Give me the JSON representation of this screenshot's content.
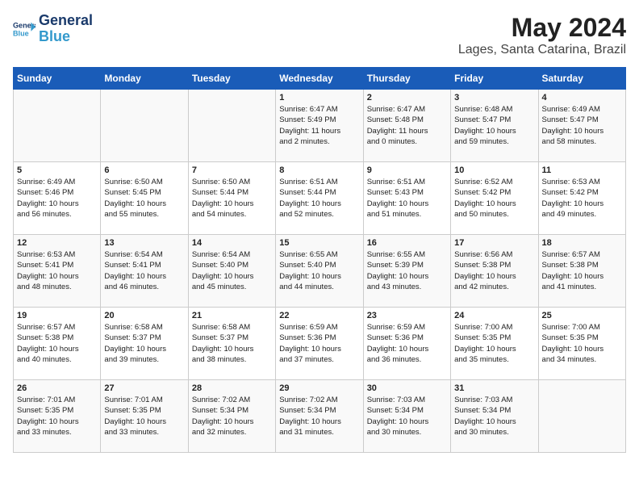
{
  "app": {
    "name": "GeneralBlue",
    "logo_label": "General\nBlue"
  },
  "calendar": {
    "title": "May 2024",
    "subtitle": "Lages, Santa Catarina, Brazil",
    "days_of_week": [
      "Sunday",
      "Monday",
      "Tuesday",
      "Wednesday",
      "Thursday",
      "Friday",
      "Saturday"
    ],
    "weeks": [
      [
        {
          "day": "",
          "info": ""
        },
        {
          "day": "",
          "info": ""
        },
        {
          "day": "",
          "info": ""
        },
        {
          "day": "1",
          "info": "Sunrise: 6:47 AM\nSunset: 5:49 PM\nDaylight: 11 hours\nand 2 minutes."
        },
        {
          "day": "2",
          "info": "Sunrise: 6:47 AM\nSunset: 5:48 PM\nDaylight: 11 hours\nand 0 minutes."
        },
        {
          "day": "3",
          "info": "Sunrise: 6:48 AM\nSunset: 5:47 PM\nDaylight: 10 hours\nand 59 minutes."
        },
        {
          "day": "4",
          "info": "Sunrise: 6:49 AM\nSunset: 5:47 PM\nDaylight: 10 hours\nand 58 minutes."
        }
      ],
      [
        {
          "day": "5",
          "info": "Sunrise: 6:49 AM\nSunset: 5:46 PM\nDaylight: 10 hours\nand 56 minutes."
        },
        {
          "day": "6",
          "info": "Sunrise: 6:50 AM\nSunset: 5:45 PM\nDaylight: 10 hours\nand 55 minutes."
        },
        {
          "day": "7",
          "info": "Sunrise: 6:50 AM\nSunset: 5:44 PM\nDaylight: 10 hours\nand 54 minutes."
        },
        {
          "day": "8",
          "info": "Sunrise: 6:51 AM\nSunset: 5:44 PM\nDaylight: 10 hours\nand 52 minutes."
        },
        {
          "day": "9",
          "info": "Sunrise: 6:51 AM\nSunset: 5:43 PM\nDaylight: 10 hours\nand 51 minutes."
        },
        {
          "day": "10",
          "info": "Sunrise: 6:52 AM\nSunset: 5:42 PM\nDaylight: 10 hours\nand 50 minutes."
        },
        {
          "day": "11",
          "info": "Sunrise: 6:53 AM\nSunset: 5:42 PM\nDaylight: 10 hours\nand 49 minutes."
        }
      ],
      [
        {
          "day": "12",
          "info": "Sunrise: 6:53 AM\nSunset: 5:41 PM\nDaylight: 10 hours\nand 48 minutes."
        },
        {
          "day": "13",
          "info": "Sunrise: 6:54 AM\nSunset: 5:41 PM\nDaylight: 10 hours\nand 46 minutes."
        },
        {
          "day": "14",
          "info": "Sunrise: 6:54 AM\nSunset: 5:40 PM\nDaylight: 10 hours\nand 45 minutes."
        },
        {
          "day": "15",
          "info": "Sunrise: 6:55 AM\nSunset: 5:40 PM\nDaylight: 10 hours\nand 44 minutes."
        },
        {
          "day": "16",
          "info": "Sunrise: 6:55 AM\nSunset: 5:39 PM\nDaylight: 10 hours\nand 43 minutes."
        },
        {
          "day": "17",
          "info": "Sunrise: 6:56 AM\nSunset: 5:38 PM\nDaylight: 10 hours\nand 42 minutes."
        },
        {
          "day": "18",
          "info": "Sunrise: 6:57 AM\nSunset: 5:38 PM\nDaylight: 10 hours\nand 41 minutes."
        }
      ],
      [
        {
          "day": "19",
          "info": "Sunrise: 6:57 AM\nSunset: 5:38 PM\nDaylight: 10 hours\nand 40 minutes."
        },
        {
          "day": "20",
          "info": "Sunrise: 6:58 AM\nSunset: 5:37 PM\nDaylight: 10 hours\nand 39 minutes."
        },
        {
          "day": "21",
          "info": "Sunrise: 6:58 AM\nSunset: 5:37 PM\nDaylight: 10 hours\nand 38 minutes."
        },
        {
          "day": "22",
          "info": "Sunrise: 6:59 AM\nSunset: 5:36 PM\nDaylight: 10 hours\nand 37 minutes."
        },
        {
          "day": "23",
          "info": "Sunrise: 6:59 AM\nSunset: 5:36 PM\nDaylight: 10 hours\nand 36 minutes."
        },
        {
          "day": "24",
          "info": "Sunrise: 7:00 AM\nSunset: 5:35 PM\nDaylight: 10 hours\nand 35 minutes."
        },
        {
          "day": "25",
          "info": "Sunrise: 7:00 AM\nSunset: 5:35 PM\nDaylight: 10 hours\nand 34 minutes."
        }
      ],
      [
        {
          "day": "26",
          "info": "Sunrise: 7:01 AM\nSunset: 5:35 PM\nDaylight: 10 hours\nand 33 minutes."
        },
        {
          "day": "27",
          "info": "Sunrise: 7:01 AM\nSunset: 5:35 PM\nDaylight: 10 hours\nand 33 minutes."
        },
        {
          "day": "28",
          "info": "Sunrise: 7:02 AM\nSunset: 5:34 PM\nDaylight: 10 hours\nand 32 minutes."
        },
        {
          "day": "29",
          "info": "Sunrise: 7:02 AM\nSunset: 5:34 PM\nDaylight: 10 hours\nand 31 minutes."
        },
        {
          "day": "30",
          "info": "Sunrise: 7:03 AM\nSunset: 5:34 PM\nDaylight: 10 hours\nand 30 minutes."
        },
        {
          "day": "31",
          "info": "Sunrise: 7:03 AM\nSunset: 5:34 PM\nDaylight: 10 hours\nand 30 minutes."
        },
        {
          "day": "",
          "info": ""
        }
      ]
    ]
  }
}
